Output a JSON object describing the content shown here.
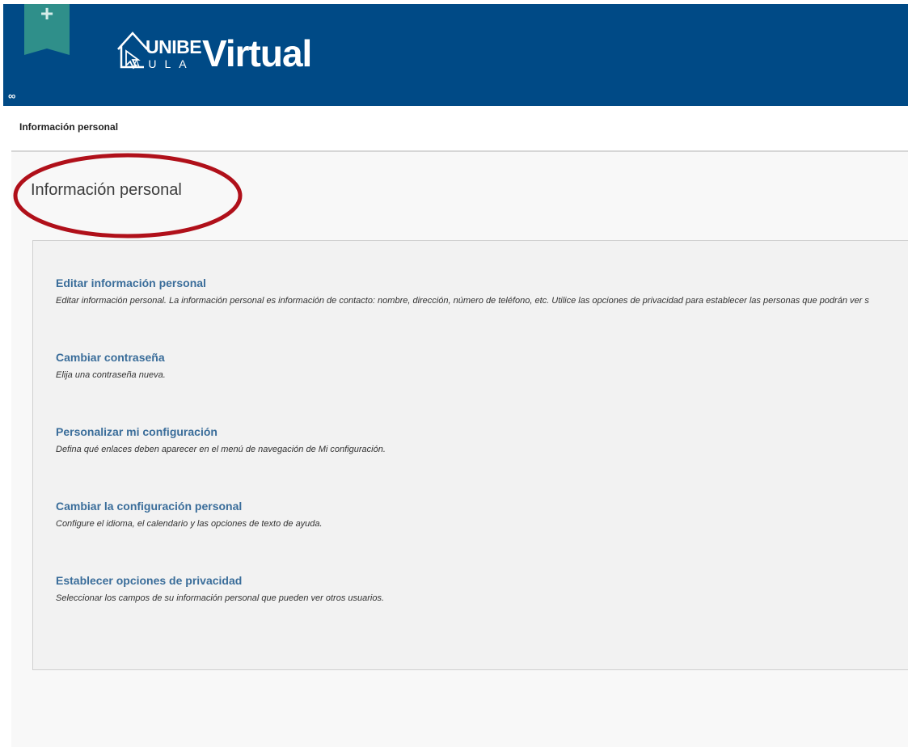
{
  "header": {
    "add_button_icon": "plus-icon",
    "logo": {
      "unibe": "UNIBE",
      "aula": "AULA",
      "virtual": "Virtual"
    },
    "link_icon": "link-icon",
    "background_color": "#004a86"
  },
  "breadcrumb": {
    "current": "Información personal"
  },
  "main": {
    "title": "Información personal",
    "items": [
      {
        "title": "Editar información personal",
        "description": "Editar información personal. La información personal es información de contacto: nombre, dirección, número de teléfono, etc. Utilice las opciones de privacidad para establecer las personas que podrán ver s"
      },
      {
        "title": "Cambiar contraseña",
        "description": "Elija una contraseña nueva."
      },
      {
        "title": "Personalizar mi configuración",
        "description": "Defina qué enlaces deben aparecer en el menú de navegación de Mi configuración."
      },
      {
        "title": "Cambiar la configuración personal",
        "description": "Configure el idioma, el calendario y las opciones de texto de ayuda."
      },
      {
        "title": "Establecer opciones de privacidad",
        "description": "Seleccionar los campos de su información personal que pueden ver otros usuarios."
      }
    ]
  },
  "colors": {
    "link": "#3a6d9a",
    "annotation_ellipse": "#b0101a",
    "add_tab": "#2f8f8a"
  }
}
